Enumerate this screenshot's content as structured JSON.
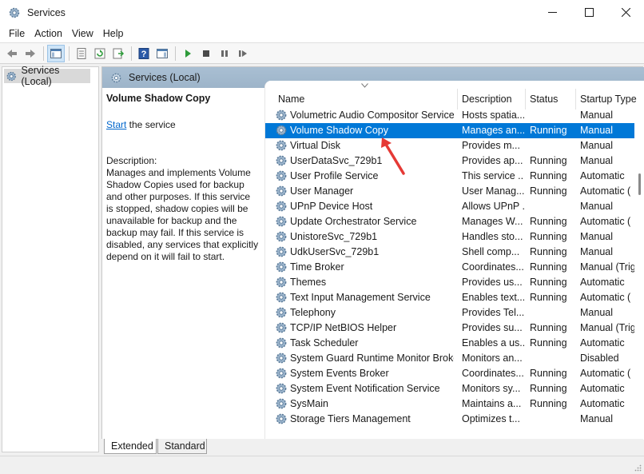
{
  "window": {
    "title": "Services",
    "icons": {
      "app": "services-gear-icon",
      "minimize": "minimize-icon",
      "maximize": "maximize-icon",
      "close": "close-icon"
    }
  },
  "menu": [
    "File",
    "Action",
    "View",
    "Help"
  ],
  "toolbar": {
    "icons": [
      "back-arrow-icon",
      "forward-arrow-icon",
      "show-console-tree-icon",
      "properties-icon",
      "refresh-icon",
      "export-list-icon",
      "help-icon",
      "show-hide-action-pane-icon",
      "start-service-icon",
      "stop-service-icon",
      "pause-service-icon",
      "restart-service-icon"
    ]
  },
  "tree": {
    "label": "Services (Local)"
  },
  "main": {
    "header": "Services (Local)",
    "details": {
      "title": "Volume Shadow Copy",
      "start_link": "Start",
      "start_suffix": " the service",
      "description_label": "Description:",
      "description": "Manages and implements Volume Shadow Copies used for backup and other purposes. If this service is stopped, shadow copies will be unavailable for backup and the backup may fail. If this service is disabled, any services that explicitly depend on it will fail to start."
    },
    "columns": {
      "name": "Name",
      "description": "Description",
      "status": "Status",
      "startup": "Startup Type"
    },
    "rows": [
      {
        "name": "Volumetric Audio Compositor Service",
        "description": "Hosts spatia...",
        "status": "",
        "startup": "Manual"
      },
      {
        "name": "Volume Shadow Copy",
        "description": "Manages an...",
        "status": "Running",
        "startup": "Manual",
        "selected": true
      },
      {
        "name": "Virtual Disk",
        "description": "Provides m...",
        "status": "",
        "startup": "Manual"
      },
      {
        "name": "UserDataSvc_729b1",
        "description": "Provides ap...",
        "status": "Running",
        "startup": "Manual"
      },
      {
        "name": "User Profile Service",
        "description": "This service ...",
        "status": "Running",
        "startup": "Automatic"
      },
      {
        "name": "User Manager",
        "description": "User Manag...",
        "status": "Running",
        "startup": "Automatic ("
      },
      {
        "name": "UPnP Device Host",
        "description": "Allows UPnP ...",
        "status": "",
        "startup": "Manual"
      },
      {
        "name": "Update Orchestrator Service",
        "description": "Manages W...",
        "status": "Running",
        "startup": "Automatic ("
      },
      {
        "name": "UnistoreSvc_729b1",
        "description": "Handles sto...",
        "status": "Running",
        "startup": "Manual"
      },
      {
        "name": "UdkUserSvc_729b1",
        "description": "Shell comp...",
        "status": "Running",
        "startup": "Manual"
      },
      {
        "name": "Time Broker",
        "description": "Coordinates...",
        "status": "Running",
        "startup": "Manual (Trig"
      },
      {
        "name": "Themes",
        "description": "Provides us...",
        "status": "Running",
        "startup": "Automatic"
      },
      {
        "name": "Text Input Management Service",
        "description": "Enables text...",
        "status": "Running",
        "startup": "Automatic ("
      },
      {
        "name": "Telephony",
        "description": "Provides Tel...",
        "status": "",
        "startup": "Manual"
      },
      {
        "name": "TCP/IP NetBIOS Helper",
        "description": "Provides su...",
        "status": "Running",
        "startup": "Manual (Trig"
      },
      {
        "name": "Task Scheduler",
        "description": "Enables a us...",
        "status": "Running",
        "startup": "Automatic"
      },
      {
        "name": "System Guard Runtime Monitor Broker",
        "description": "Monitors an...",
        "status": "",
        "startup": "Disabled"
      },
      {
        "name": "System Events Broker",
        "description": "Coordinates...",
        "status": "Running",
        "startup": "Automatic ("
      },
      {
        "name": "System Event Notification Service",
        "description": "Monitors sy...",
        "status": "Running",
        "startup": "Automatic"
      },
      {
        "name": "SysMain",
        "description": "Maintains a...",
        "status": "Running",
        "startup": "Automatic"
      },
      {
        "name": "Storage Tiers Management",
        "description": "Optimizes t...",
        "status": "",
        "startup": "Manual"
      }
    ],
    "row_icon": "service-gear-icon"
  },
  "tabs": [
    "Extended",
    "Standard"
  ],
  "colors": {
    "selection": "#0078d7",
    "header": "#a9bfd3",
    "link": "#0066cc",
    "annotation": "#e53935"
  }
}
